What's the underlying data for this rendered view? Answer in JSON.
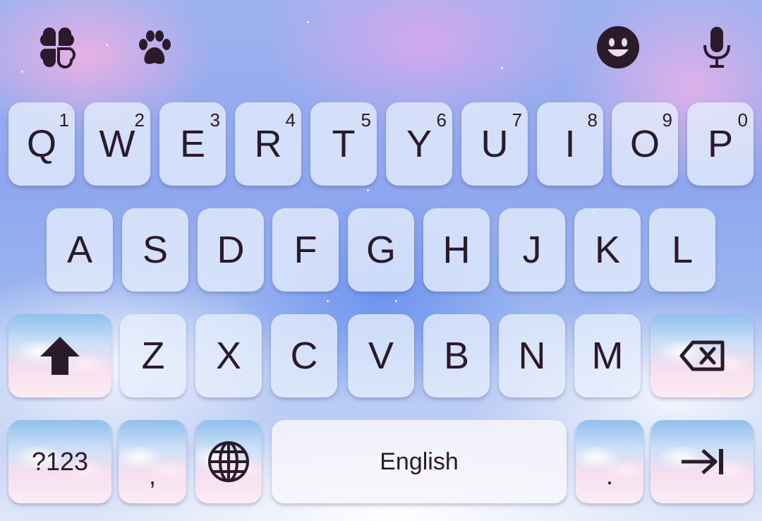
{
  "toolbar": {
    "left_icons": [
      "clover-icon",
      "paw-icon"
    ],
    "right_icons": [
      "emoji-icon",
      "microphone-icon"
    ]
  },
  "keyboard": {
    "row1": [
      {
        "letter": "Q",
        "num": "1"
      },
      {
        "letter": "W",
        "num": "2"
      },
      {
        "letter": "E",
        "num": "3"
      },
      {
        "letter": "R",
        "num": "4"
      },
      {
        "letter": "T",
        "num": "5"
      },
      {
        "letter": "Y",
        "num": "6"
      },
      {
        "letter": "U",
        "num": "7"
      },
      {
        "letter": "I",
        "num": "8"
      },
      {
        "letter": "O",
        "num": "9"
      },
      {
        "letter": "P",
        "num": "0"
      }
    ],
    "row2": [
      "A",
      "S",
      "D",
      "F",
      "G",
      "H",
      "J",
      "K",
      "L"
    ],
    "row3": [
      "Z",
      "X",
      "C",
      "V",
      "B",
      "N",
      "M"
    ],
    "bottom": {
      "symbols_label": "?123",
      "comma_label": ",",
      "space_label": "English",
      "period_label": "."
    },
    "icons": {
      "shift": "shift-icon",
      "backspace": "backspace-icon",
      "globe": "globe-icon",
      "enter": "tab-arrow-icon"
    }
  },
  "colors": {
    "key_text": "#2a1a2a",
    "key_fill": "#e7eefc"
  }
}
